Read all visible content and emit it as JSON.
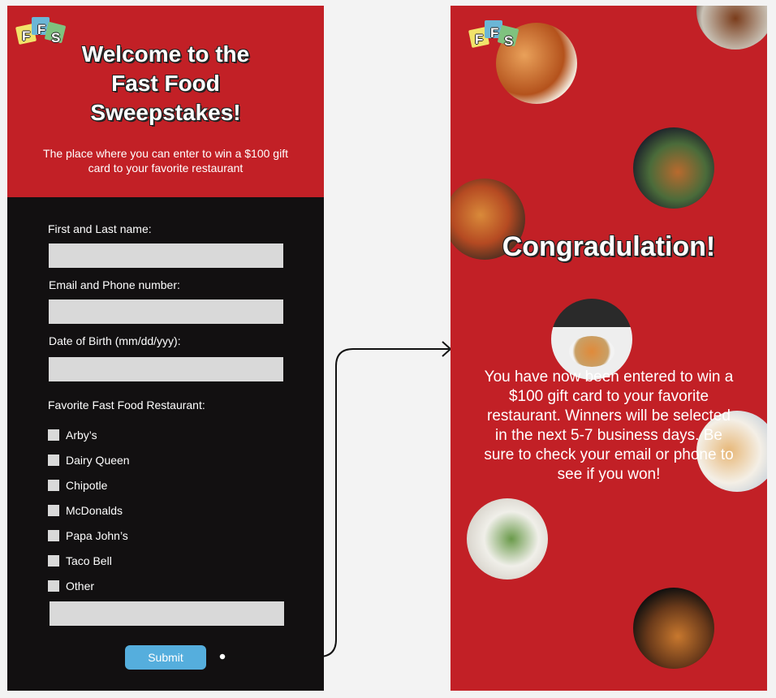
{
  "logo": {
    "letters": [
      "F",
      "F",
      "S"
    ]
  },
  "left": {
    "title": "Welcome to the Fast Food Sweepstakes!",
    "subtitle": "The place where you can enter to win a $100 gift card to your favorite restaurant",
    "form": {
      "name_label": "First and Last name:",
      "contact_label": "Email and Phone number:",
      "dob_label": "Date of Birth (mm/dd/yyy):",
      "restaurant_label": "Favorite Fast Food Restaurant:",
      "options": [
        "Arby’s",
        "Dairy Queen",
        "Chipotle",
        "McDonalds",
        "Papa John’s",
        "Taco Bell",
        "Other"
      ],
      "submit_label": "Submit"
    }
  },
  "right": {
    "title": "Congradulation!",
    "message": "You have now been entered to win a $100 gift card to your favorite restaurant. Winners will be selected in the next 5-7 business days. Be sure to check your email or phone to see if you won!",
    "food_images": [
      "chicken-wings",
      "steak-plate",
      "fried-chicken-tenders",
      "pizza",
      "pasta",
      "hot-dog",
      "sushi",
      "burger-and-fries"
    ]
  },
  "colors": {
    "brand_red": "#c22026",
    "dark_bg": "#121011",
    "field_gray": "#d9d9d9",
    "button_blue": "#55aedd"
  }
}
